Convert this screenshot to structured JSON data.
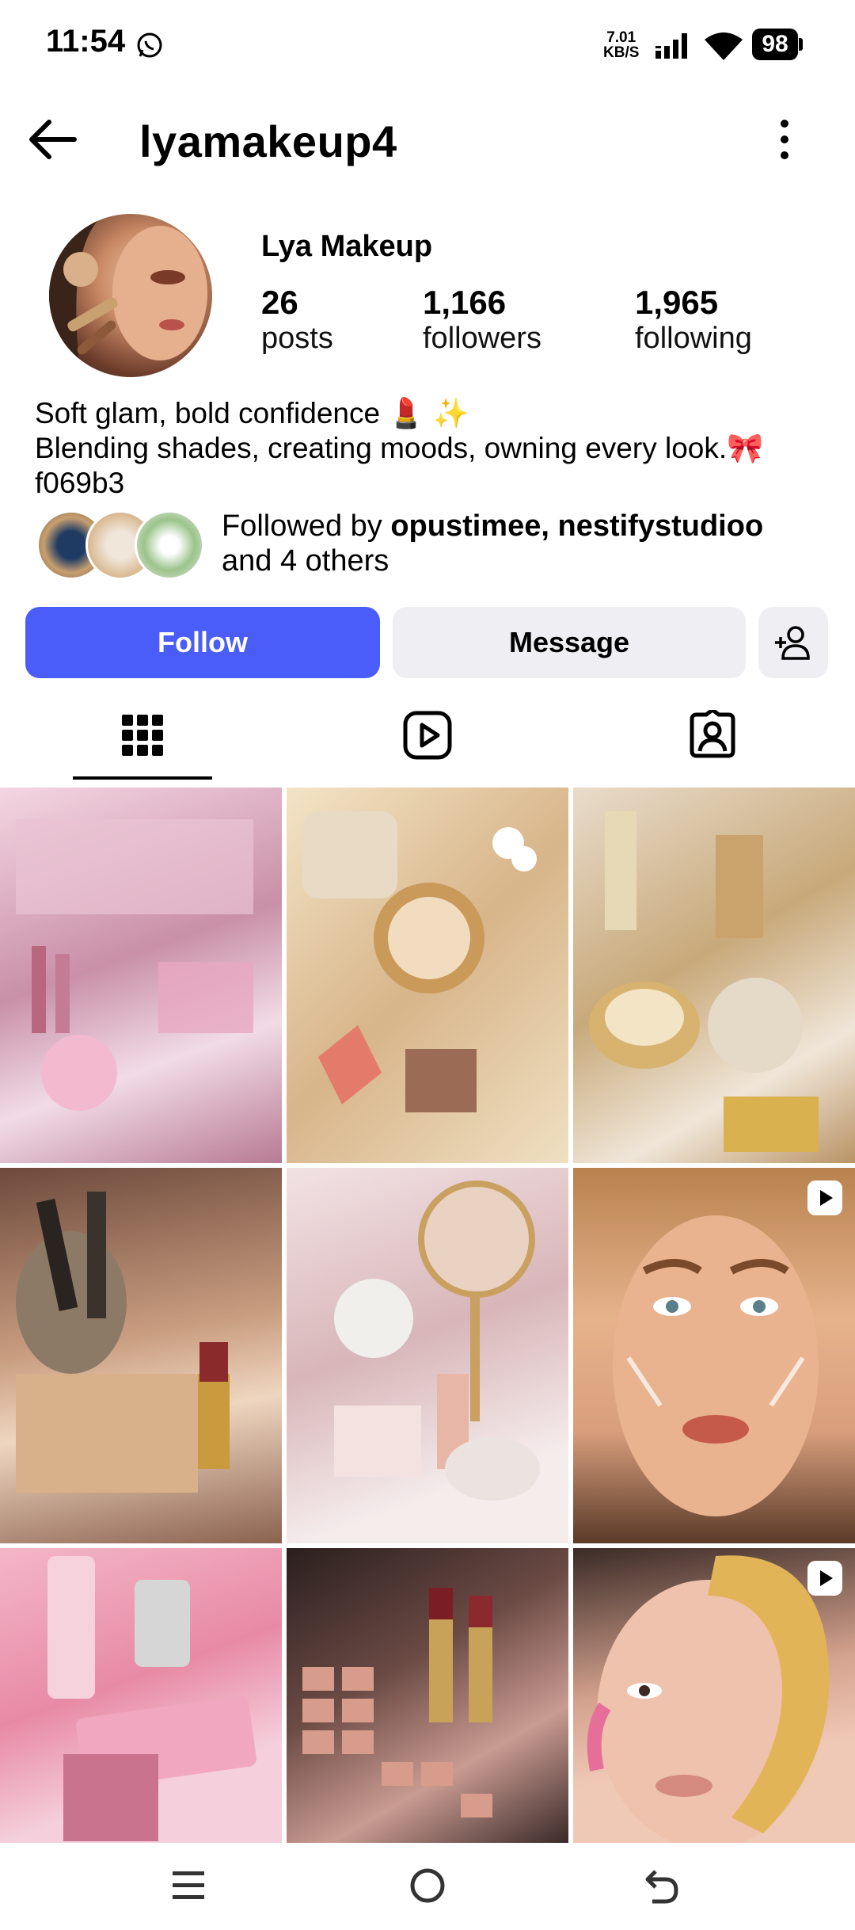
{
  "status_bar": {
    "time": "11:54",
    "net_speed_value": "7.01",
    "net_speed_unit": "KB/S",
    "battery": "98",
    "icons": [
      "whatsapp-icon",
      "signal-icon",
      "wifi-icon",
      "battery-icon"
    ]
  },
  "header": {
    "username": "lyamakeup4",
    "icons": [
      "back-arrow-icon",
      "more-vert-icon"
    ]
  },
  "profile": {
    "display_name": "Lya Makeup",
    "stats": [
      {
        "value": "26",
        "label": "posts"
      },
      {
        "value": "1,166",
        "label": "followers"
      },
      {
        "value": "1,965",
        "label": "following"
      }
    ],
    "bio_lines": [
      "Soft glam, bold confidence 💄 ✨",
      "Blending shades, creating moods, owning every look.🎀",
      "f069b3"
    ],
    "followed_by_prefix": "Followed by ",
    "followed_by_names": "opustimee, nestifystudioo",
    "followed_by_suffix": "and 4 others"
  },
  "actions": {
    "follow_label": "Follow",
    "message_label": "Message"
  },
  "tabs": [
    {
      "icon": "grid-icon",
      "selected": true
    },
    {
      "icon": "reels-icon",
      "selected": false
    },
    {
      "icon": "tagged-icon",
      "selected": false
    }
  ],
  "grid": [
    {
      "theme": "pink-perfume-vanity",
      "reel": false
    },
    {
      "theme": "gold-watch-jewelry",
      "reel": false
    },
    {
      "theme": "luxury-gold-cosmetics",
      "reel": false
    },
    {
      "theme": "brush-and-highlighter",
      "reel": false
    },
    {
      "theme": "vanity-mirror-products",
      "reel": false
    },
    {
      "theme": "face-contour-tutorial",
      "reel": true
    },
    {
      "theme": "pink-lip-gloss",
      "reel": false
    },
    {
      "theme": "eyeshadow-palette-lipstick",
      "reel": false
    },
    {
      "theme": "foundation-application",
      "reel": true
    }
  ],
  "colors": {
    "accent": "#4a5df9",
    "secondary_button": "#efeff3"
  }
}
